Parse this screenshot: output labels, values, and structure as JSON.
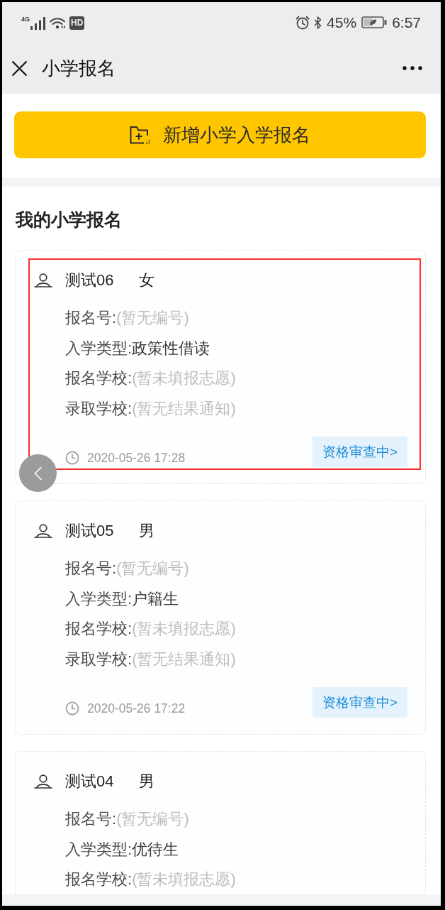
{
  "status_bar": {
    "network": "4G",
    "hd": "HD",
    "battery": "45%",
    "time": "6:57"
  },
  "nav_bar": {
    "title": "小学报名"
  },
  "add_button": {
    "label": "新增小学入学报名"
  },
  "section_title": "我的小学报名",
  "cards": [
    {
      "name": "测试06",
      "gender": "女",
      "highlighted": true,
      "fields": [
        {
          "label": "报名号:",
          "placeholder": "(暂无编号)"
        },
        {
          "label": "入学类型:",
          "value": "政策性借读"
        },
        {
          "label": "报名学校:",
          "placeholder": "(暂未填报志愿)"
        },
        {
          "label": "录取学校:",
          "placeholder": "(暂无结果通知)"
        }
      ],
      "time": "2020-05-26 17:28",
      "status": "资格审查中>"
    },
    {
      "name": "测试05",
      "gender": "男",
      "highlighted": false,
      "fields": [
        {
          "label": "报名号:",
          "placeholder": "(暂无编号)"
        },
        {
          "label": "入学类型:",
          "value": "户籍生"
        },
        {
          "label": "报名学校:",
          "placeholder": "(暂未填报志愿)"
        },
        {
          "label": "录取学校:",
          "placeholder": "(暂无结果通知)"
        }
      ],
      "time": "2020-05-26 17:22",
      "status": "资格审查中>"
    },
    {
      "name": "测试04",
      "gender": "男",
      "highlighted": false,
      "fields": [
        {
          "label": "报名号:",
          "placeholder": "(暂无编号)"
        },
        {
          "label": "入学类型:",
          "value": "优待生"
        },
        {
          "label": "报名学校:",
          "placeholder": "(暂未填报志愿)"
        }
      ]
    }
  ]
}
